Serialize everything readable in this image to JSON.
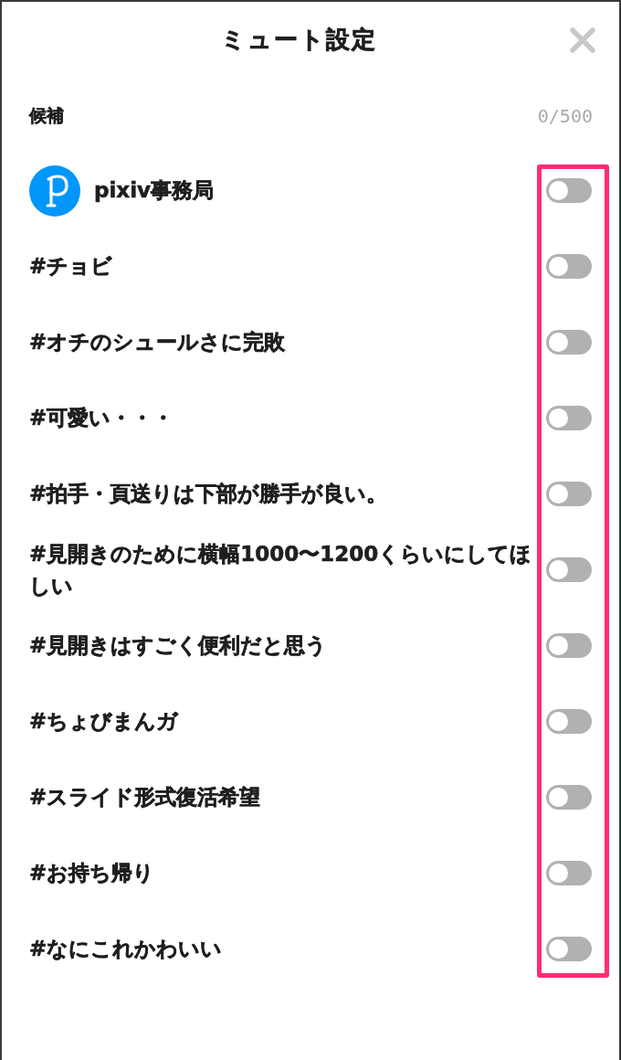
{
  "dialog": {
    "title": "ミュート設定"
  },
  "candidates": {
    "label": "候補",
    "count": "0/500"
  },
  "items": [
    {
      "kind": "user",
      "label": "pixiv事務局",
      "on": false
    },
    {
      "kind": "tag",
      "label": "#チョビ",
      "on": false
    },
    {
      "kind": "tag",
      "label": "#オチのシュールさに完敗",
      "on": false
    },
    {
      "kind": "tag",
      "label": "#可愛い・・・",
      "on": false
    },
    {
      "kind": "tag",
      "label": "#拍手・頁送りは下部が勝手が良い。",
      "on": false
    },
    {
      "kind": "tag",
      "label": "#見開きのために横幅1000〜1200くらいにしてほしい",
      "on": false
    },
    {
      "kind": "tag",
      "label": "#見開きはすごく便利だと思う",
      "on": false
    },
    {
      "kind": "tag",
      "label": "#ちょびまんガ",
      "on": false
    },
    {
      "kind": "tag",
      "label": "#スライド形式復活希望",
      "on": false
    },
    {
      "kind": "tag",
      "label": "#お持ち帰り",
      "on": false
    },
    {
      "kind": "tag",
      "label": "#なにこれかわいい",
      "on": false
    }
  ],
  "toggles_highlighted": true
}
